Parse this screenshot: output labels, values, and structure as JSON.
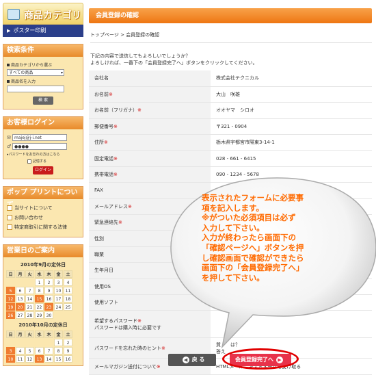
{
  "sidebar": {
    "category_title": "商品カテゴリ",
    "poster_label": "ポスター印刷",
    "search": {
      "title": "検索条件",
      "category_label": "商品カテゴリから選ぶ",
      "category_value": "すべての商品",
      "name_label": "商品名を入力",
      "button": "検 索"
    },
    "login": {
      "title": "お客様ログイン",
      "email": "majej@j-i.net",
      "password": "●●●●",
      "forgot": "パスワードをお忘れの方はこちら",
      "remember": "記憶する",
      "button": "ログイン"
    },
    "links": {
      "title": "ポップ プリントについて",
      "items": [
        "当サイトについて",
        "お問い合わせ",
        "特定商取引に関する法律"
      ]
    },
    "calendar": {
      "title": "営業日のご案内",
      "days": [
        "日",
        "月",
        "火",
        "水",
        "木",
        "金",
        "土"
      ],
      "month1": {
        "title": "2010年9月の定休日",
        "cells": [
          "",
          "",
          "",
          "1",
          "2",
          "3",
          "4",
          "5",
          "6",
          "7",
          "8",
          "9",
          "10",
          "11",
          "12",
          "13",
          "14",
          "15",
          "16",
          "17",
          "18",
          "19",
          "20",
          "21",
          "22",
          "23",
          "24",
          "25",
          "26",
          "27",
          "28",
          "29",
          "30",
          "",
          ""
        ],
        "holidays": [
          "5",
          "12",
          "15",
          "19",
          "20",
          "23",
          "26"
        ]
      },
      "month2": {
        "title": "2010年10月の定休日",
        "cells": [
          "",
          "",
          "",
          "",
          "",
          "1",
          "2",
          "3",
          "4",
          "5",
          "6",
          "7",
          "8",
          "9",
          "10",
          "11",
          "12",
          "13",
          "14",
          "15",
          "16"
        ],
        "holidays": [
          "3",
          "10",
          "13"
        ]
      }
    }
  },
  "main": {
    "title": "会員登録の確認",
    "breadcrumb": "トップページ > 会員登録の確認",
    "intro1": "下記の内容で送信してもよろしいでしょうか？",
    "intro2": "よろしければ、一番下の「会員登録完了へ」ボタンをクリックしてください。",
    "rows": [
      {
        "label": "会社名",
        "req": "",
        "value": "株式会社テクニカル"
      },
      {
        "label": "お名前",
        "req": "※",
        "value": "大山　咲雄"
      },
      {
        "label": "お名前（フリガナ）",
        "req": "※",
        "value": "オオヤマ　シロオ"
      },
      {
        "label": "郵便番号",
        "req": "※",
        "value": "〒321 - 0904"
      },
      {
        "label": "住所",
        "req": "※",
        "value": "栃木県宇都宮市陽東3-14-1"
      },
      {
        "label": "固定電話",
        "req": "※",
        "value": "028 - 661 - 6415"
      },
      {
        "label": "携帯電話",
        "req": "※",
        "value": "090 - 1234 - 5678"
      },
      {
        "label": "FAX",
        "req": "",
        "value": "028"
      },
      {
        "label": "メールアドレス",
        "req": "※",
        "value": ""
      },
      {
        "label": "緊急連絡先",
        "req": "※",
        "value": ""
      },
      {
        "label": "性別",
        "req": "",
        "value": ""
      },
      {
        "label": "職業",
        "req": "",
        "value": ""
      },
      {
        "label": "生年月日",
        "req": "",
        "value": ""
      },
      {
        "label": "使用OS",
        "req": "",
        "value": ""
      },
      {
        "label": "使用ソフト",
        "req": "",
        "value": ""
      }
    ],
    "password_label1": "希望するパスワード",
    "password_req": "※",
    "password_label2": "パスワードは購入時に必要です",
    "hint_label": "パスワードを忘れた時のヒント",
    "hint_req": "※",
    "hint_value1": "質　　は？",
    "hint_value2": "答え",
    "magazine_label": "メールマガジン送付について",
    "magazine_req": "※",
    "magazine_value": "HTMLメール　キストメールを受け取る",
    "back_button": "戻 る",
    "next_button": "会員登録完了へ"
  },
  "callout": {
    "lines": [
      "表示されたフォームに必要事",
      "項を記入します。",
      "※がついた必須項目は必ず",
      "入力して下さい。",
      "入力が終わったら画面下の",
      "「確認ページへ」ボタンを押",
      "し確認画面で確認ができたら",
      "画面下の「会員登録完了へ」",
      "を押して下さい。"
    ]
  }
}
